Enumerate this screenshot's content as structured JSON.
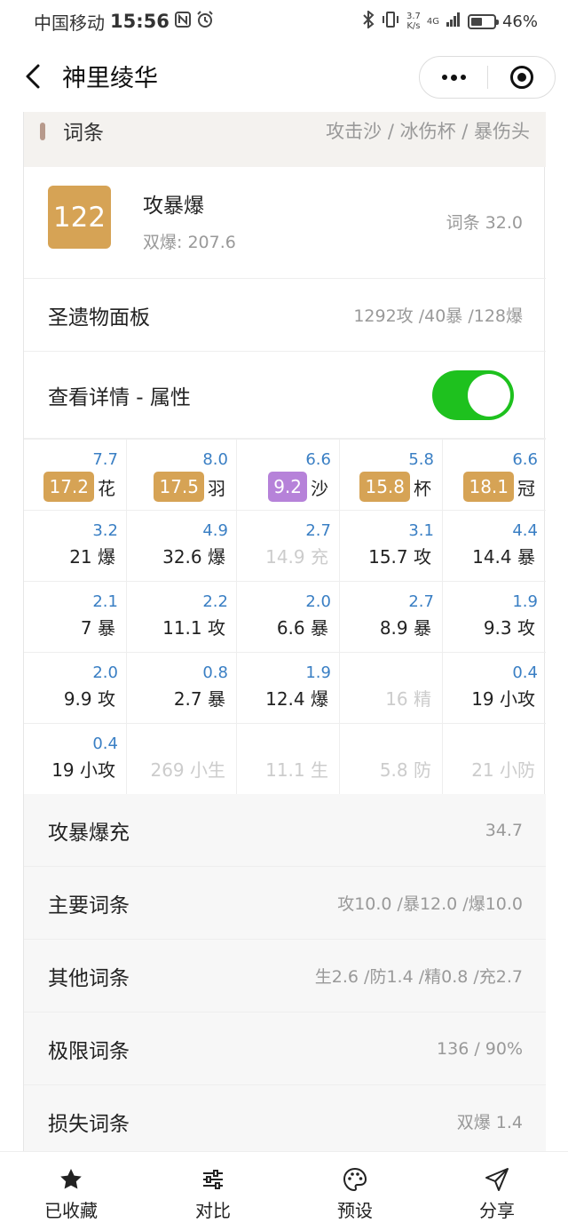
{
  "status_bar": {
    "carrier": "中国移动",
    "time": "15:56",
    "net_speed_value": "3.7",
    "net_speed_unit": "K/s",
    "network": "4G",
    "battery": "46%"
  },
  "nav": {
    "title": "神里绫华"
  },
  "header": {
    "label": "词条",
    "value": "攻击沙 / 冰伤杯 / 暴伤头"
  },
  "score": {
    "value": "122",
    "type": "攻暴爆",
    "sub": "双爆: 207.6",
    "right": "词条 32.0"
  },
  "artifact_panel": {
    "label": "圣遗物面板",
    "value": "1292攻 /40暴 /128爆"
  },
  "details": {
    "label": "查看详情 - 属性",
    "toggle_on": true
  },
  "grid": {
    "header": [
      {
        "add": "7.7",
        "score": "17.2",
        "slot": "花",
        "color": "gold"
      },
      {
        "add": "8.0",
        "score": "17.5",
        "slot": "羽",
        "color": "gold"
      },
      {
        "add": "6.6",
        "score": "9.2",
        "slot": "沙",
        "color": "purple"
      },
      {
        "add": "5.8",
        "score": "15.8",
        "slot": "杯",
        "color": "gold"
      },
      {
        "add": "6.6",
        "score": "18.1",
        "slot": "冠",
        "color": "gold"
      }
    ],
    "rows": [
      [
        {
          "add": "3.2",
          "text": "21 爆",
          "dim": false
        },
        {
          "add": "4.9",
          "text": "32.6 爆",
          "dim": false
        },
        {
          "add": "2.7",
          "text": "14.9 充",
          "dim": true
        },
        {
          "add": "3.1",
          "text": "15.7 攻",
          "dim": false
        },
        {
          "add": "4.4",
          "text": "14.4 暴",
          "dim": false
        }
      ],
      [
        {
          "add": "2.1",
          "text": "7 暴",
          "dim": false
        },
        {
          "add": "2.2",
          "text": "11.1 攻",
          "dim": false
        },
        {
          "add": "2.0",
          "text": "6.6 暴",
          "dim": false
        },
        {
          "add": "2.7",
          "text": "8.9 暴",
          "dim": false
        },
        {
          "add": "1.9",
          "text": "9.3 攻",
          "dim": false
        }
      ],
      [
        {
          "add": "2.0",
          "text": "9.9 攻",
          "dim": false
        },
        {
          "add": "0.8",
          "text": "2.7 暴",
          "dim": false
        },
        {
          "add": "1.9",
          "text": "12.4 爆",
          "dim": false
        },
        {
          "add": "",
          "text": "16 精",
          "dim": true
        },
        {
          "add": "0.4",
          "text": "19 小攻",
          "dim": false
        }
      ],
      [
        {
          "add": "0.4",
          "text": "19 小攻",
          "dim": false
        },
        {
          "add": "",
          "text": "269 小生",
          "dim": true
        },
        {
          "add": "",
          "text": "11.1 生",
          "dim": true
        },
        {
          "add": "",
          "text": "5.8 防",
          "dim": true
        },
        {
          "add": "",
          "text": "21 小防",
          "dim": true
        }
      ]
    ]
  },
  "stats": [
    {
      "label": "攻暴爆充",
      "value": "34.7"
    },
    {
      "label": "主要词条",
      "value": "攻10.0 /暴12.0 /爆10.0"
    },
    {
      "label": "其他词条",
      "value": "生2.6 /防1.4 /精0.8 /充2.7"
    },
    {
      "label": "极限词条",
      "value": "136 / 90%"
    },
    {
      "label": "损失词条",
      "value": "双爆 1.4"
    }
  ],
  "tabs": [
    {
      "label": "已收藏",
      "icon": "star-icon"
    },
    {
      "label": "对比",
      "icon": "sliders-icon"
    },
    {
      "label": "预设",
      "icon": "palette-icon"
    },
    {
      "label": "分享",
      "icon": "send-icon"
    }
  ]
}
